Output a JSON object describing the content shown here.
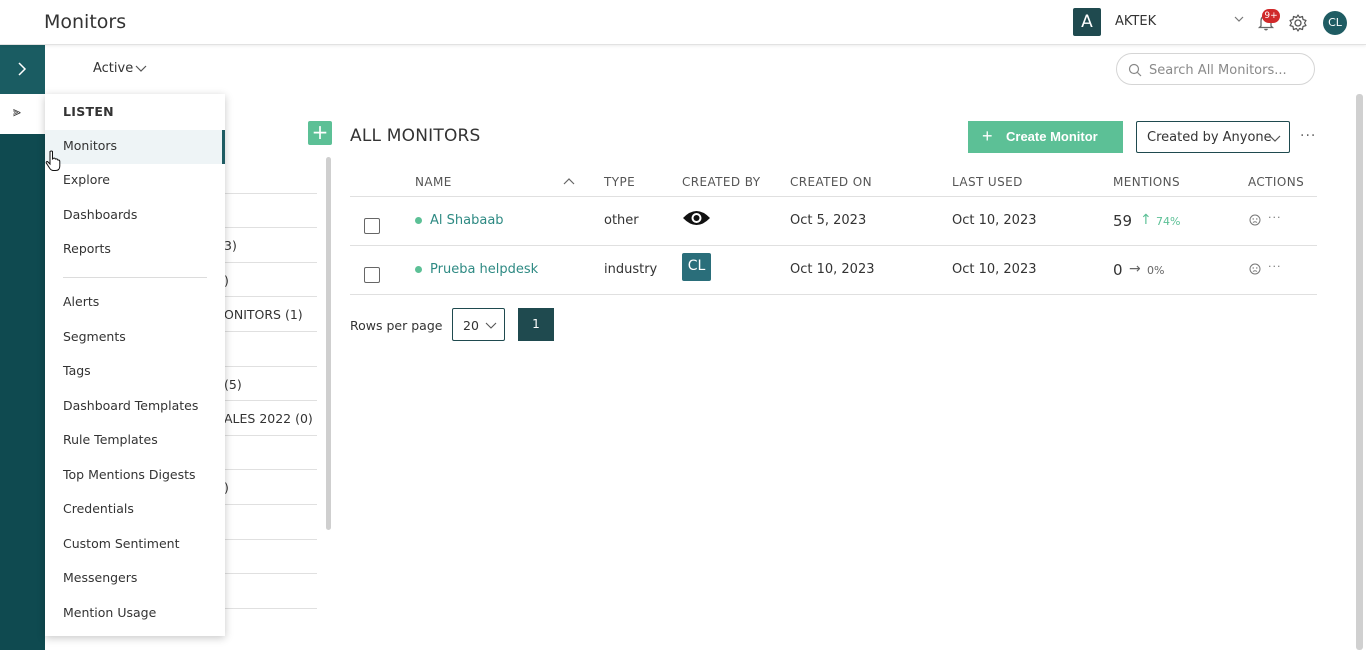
{
  "header": {
    "title": "Monitors",
    "brand_initial": "A",
    "brand_name": "AKTEK",
    "notification_badge": "9+",
    "user_initials": "CL"
  },
  "subheader": {
    "status_filter": "Active",
    "search_placeholder": "Search All Monitors..."
  },
  "menu": {
    "heading": "LISTEN",
    "group1": [
      "Monitors",
      "Explore",
      "Dashboards",
      "Reports"
    ],
    "group2": [
      "Alerts",
      "Segments",
      "Tags",
      "Dashboard Templates",
      "Rule Templates",
      "Top Mentions Digests",
      "Credentials",
      "Custom Sentiment",
      "Messengers",
      "Mention Usage"
    ],
    "active_item": "Monitors"
  },
  "folders": {
    "visible_fragments": [
      "",
      "",
      "3)",
      ")",
      "ONITORS  (1)",
      "",
      "(5)",
      "ALES 2022  (0)",
      "",
      ")",
      "",
      "",
      ""
    ]
  },
  "main": {
    "title": "ALL MONITORS",
    "create_button": "Create Monitor",
    "created_by_filter": "Created by Anyone",
    "columns": [
      "NAME",
      "TYPE",
      "CREATED BY",
      "CREATED ON",
      "LAST USED",
      "MENTIONS",
      "ACTIONS"
    ],
    "rows": [
      {
        "name": "Al Shabaab",
        "type": "other",
        "created_by": "eye-icon",
        "created_on": "Oct 5, 2023",
        "last_used": "Oct 10, 2023",
        "mentions": "59",
        "trend_arrow": "↑",
        "trend_pct": "74%",
        "trend_color": "#5cc096"
      },
      {
        "name": "Prueba helpdesk",
        "type": "industry",
        "created_by": "CL",
        "created_on": "Oct 10, 2023",
        "last_used": "Oct 10, 2023",
        "mentions": "0",
        "trend_arrow": "→",
        "trend_pct": "0%",
        "trend_color": "#666666"
      }
    ],
    "rows_per_page_label": "Rows per page",
    "rows_per_page": "20",
    "current_page": "1"
  },
  "colors": {
    "rail": "#0f4a50",
    "accent_green": "#5cc096",
    "dark_teal": "#1f4a4f",
    "link": "#2e8a83"
  }
}
